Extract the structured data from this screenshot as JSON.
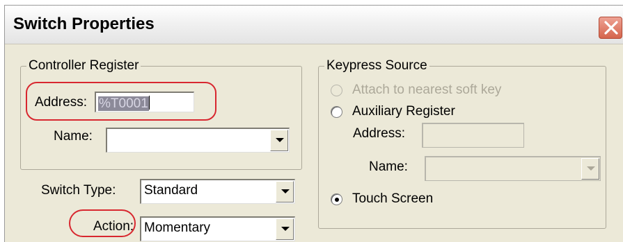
{
  "dialog": {
    "title": "Switch Properties",
    "close_icon": "close-icon"
  },
  "controller_register": {
    "legend": "Controller Register",
    "address_label": "Address:",
    "address_value": "%T0001",
    "name_label": "Name:",
    "name_value": ""
  },
  "switch_type": {
    "label": "Switch Type:",
    "value": "Standard"
  },
  "action": {
    "label": "Action:",
    "value": "Momentary"
  },
  "keypress_source": {
    "legend": "Keypress Source",
    "options": [
      {
        "label": "Attach to nearest soft key",
        "selected": false,
        "enabled": false
      },
      {
        "label": "Auxiliary Register",
        "selected": false,
        "enabled": true
      },
      {
        "label": "Touch Screen",
        "selected": true,
        "enabled": true
      }
    ],
    "aux_address_label": "Address:",
    "aux_address_value": "",
    "aux_name_label": "Name:",
    "aux_name_value": ""
  },
  "colors": {
    "annotation": "#d8272f",
    "dialog_face": "#ece9d8"
  }
}
